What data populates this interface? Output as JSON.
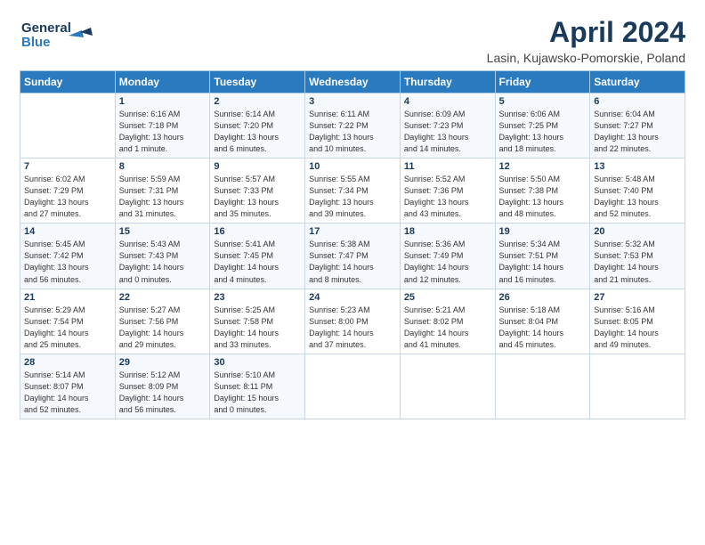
{
  "header": {
    "logo_line1": "General",
    "logo_line2": "Blue",
    "month_title": "April 2024",
    "location": "Lasin, Kujawsko-Pomorskie, Poland"
  },
  "weekdays": [
    "Sunday",
    "Monday",
    "Tuesday",
    "Wednesday",
    "Thursday",
    "Friday",
    "Saturday"
  ],
  "weeks": [
    [
      {
        "day": "",
        "info": ""
      },
      {
        "day": "1",
        "info": "Sunrise: 6:16 AM\nSunset: 7:18 PM\nDaylight: 13 hours\nand 1 minute."
      },
      {
        "day": "2",
        "info": "Sunrise: 6:14 AM\nSunset: 7:20 PM\nDaylight: 13 hours\nand 6 minutes."
      },
      {
        "day": "3",
        "info": "Sunrise: 6:11 AM\nSunset: 7:22 PM\nDaylight: 13 hours\nand 10 minutes."
      },
      {
        "day": "4",
        "info": "Sunrise: 6:09 AM\nSunset: 7:23 PM\nDaylight: 13 hours\nand 14 minutes."
      },
      {
        "day": "5",
        "info": "Sunrise: 6:06 AM\nSunset: 7:25 PM\nDaylight: 13 hours\nand 18 minutes."
      },
      {
        "day": "6",
        "info": "Sunrise: 6:04 AM\nSunset: 7:27 PM\nDaylight: 13 hours\nand 22 minutes."
      }
    ],
    [
      {
        "day": "7",
        "info": "Sunrise: 6:02 AM\nSunset: 7:29 PM\nDaylight: 13 hours\nand 27 minutes."
      },
      {
        "day": "8",
        "info": "Sunrise: 5:59 AM\nSunset: 7:31 PM\nDaylight: 13 hours\nand 31 minutes."
      },
      {
        "day": "9",
        "info": "Sunrise: 5:57 AM\nSunset: 7:33 PM\nDaylight: 13 hours\nand 35 minutes."
      },
      {
        "day": "10",
        "info": "Sunrise: 5:55 AM\nSunset: 7:34 PM\nDaylight: 13 hours\nand 39 minutes."
      },
      {
        "day": "11",
        "info": "Sunrise: 5:52 AM\nSunset: 7:36 PM\nDaylight: 13 hours\nand 43 minutes."
      },
      {
        "day": "12",
        "info": "Sunrise: 5:50 AM\nSunset: 7:38 PM\nDaylight: 13 hours\nand 48 minutes."
      },
      {
        "day": "13",
        "info": "Sunrise: 5:48 AM\nSunset: 7:40 PM\nDaylight: 13 hours\nand 52 minutes."
      }
    ],
    [
      {
        "day": "14",
        "info": "Sunrise: 5:45 AM\nSunset: 7:42 PM\nDaylight: 13 hours\nand 56 minutes."
      },
      {
        "day": "15",
        "info": "Sunrise: 5:43 AM\nSunset: 7:43 PM\nDaylight: 14 hours\nand 0 minutes."
      },
      {
        "day": "16",
        "info": "Sunrise: 5:41 AM\nSunset: 7:45 PM\nDaylight: 14 hours\nand 4 minutes."
      },
      {
        "day": "17",
        "info": "Sunrise: 5:38 AM\nSunset: 7:47 PM\nDaylight: 14 hours\nand 8 minutes."
      },
      {
        "day": "18",
        "info": "Sunrise: 5:36 AM\nSunset: 7:49 PM\nDaylight: 14 hours\nand 12 minutes."
      },
      {
        "day": "19",
        "info": "Sunrise: 5:34 AM\nSunset: 7:51 PM\nDaylight: 14 hours\nand 16 minutes."
      },
      {
        "day": "20",
        "info": "Sunrise: 5:32 AM\nSunset: 7:53 PM\nDaylight: 14 hours\nand 21 minutes."
      }
    ],
    [
      {
        "day": "21",
        "info": "Sunrise: 5:29 AM\nSunset: 7:54 PM\nDaylight: 14 hours\nand 25 minutes."
      },
      {
        "day": "22",
        "info": "Sunrise: 5:27 AM\nSunset: 7:56 PM\nDaylight: 14 hours\nand 29 minutes."
      },
      {
        "day": "23",
        "info": "Sunrise: 5:25 AM\nSunset: 7:58 PM\nDaylight: 14 hours\nand 33 minutes."
      },
      {
        "day": "24",
        "info": "Sunrise: 5:23 AM\nSunset: 8:00 PM\nDaylight: 14 hours\nand 37 minutes."
      },
      {
        "day": "25",
        "info": "Sunrise: 5:21 AM\nSunset: 8:02 PM\nDaylight: 14 hours\nand 41 minutes."
      },
      {
        "day": "26",
        "info": "Sunrise: 5:18 AM\nSunset: 8:04 PM\nDaylight: 14 hours\nand 45 minutes."
      },
      {
        "day": "27",
        "info": "Sunrise: 5:16 AM\nSunset: 8:05 PM\nDaylight: 14 hours\nand 49 minutes."
      }
    ],
    [
      {
        "day": "28",
        "info": "Sunrise: 5:14 AM\nSunset: 8:07 PM\nDaylight: 14 hours\nand 52 minutes."
      },
      {
        "day": "29",
        "info": "Sunrise: 5:12 AM\nSunset: 8:09 PM\nDaylight: 14 hours\nand 56 minutes."
      },
      {
        "day": "30",
        "info": "Sunrise: 5:10 AM\nSunset: 8:11 PM\nDaylight: 15 hours\nand 0 minutes."
      },
      {
        "day": "",
        "info": ""
      },
      {
        "day": "",
        "info": ""
      },
      {
        "day": "",
        "info": ""
      },
      {
        "day": "",
        "info": ""
      }
    ]
  ]
}
